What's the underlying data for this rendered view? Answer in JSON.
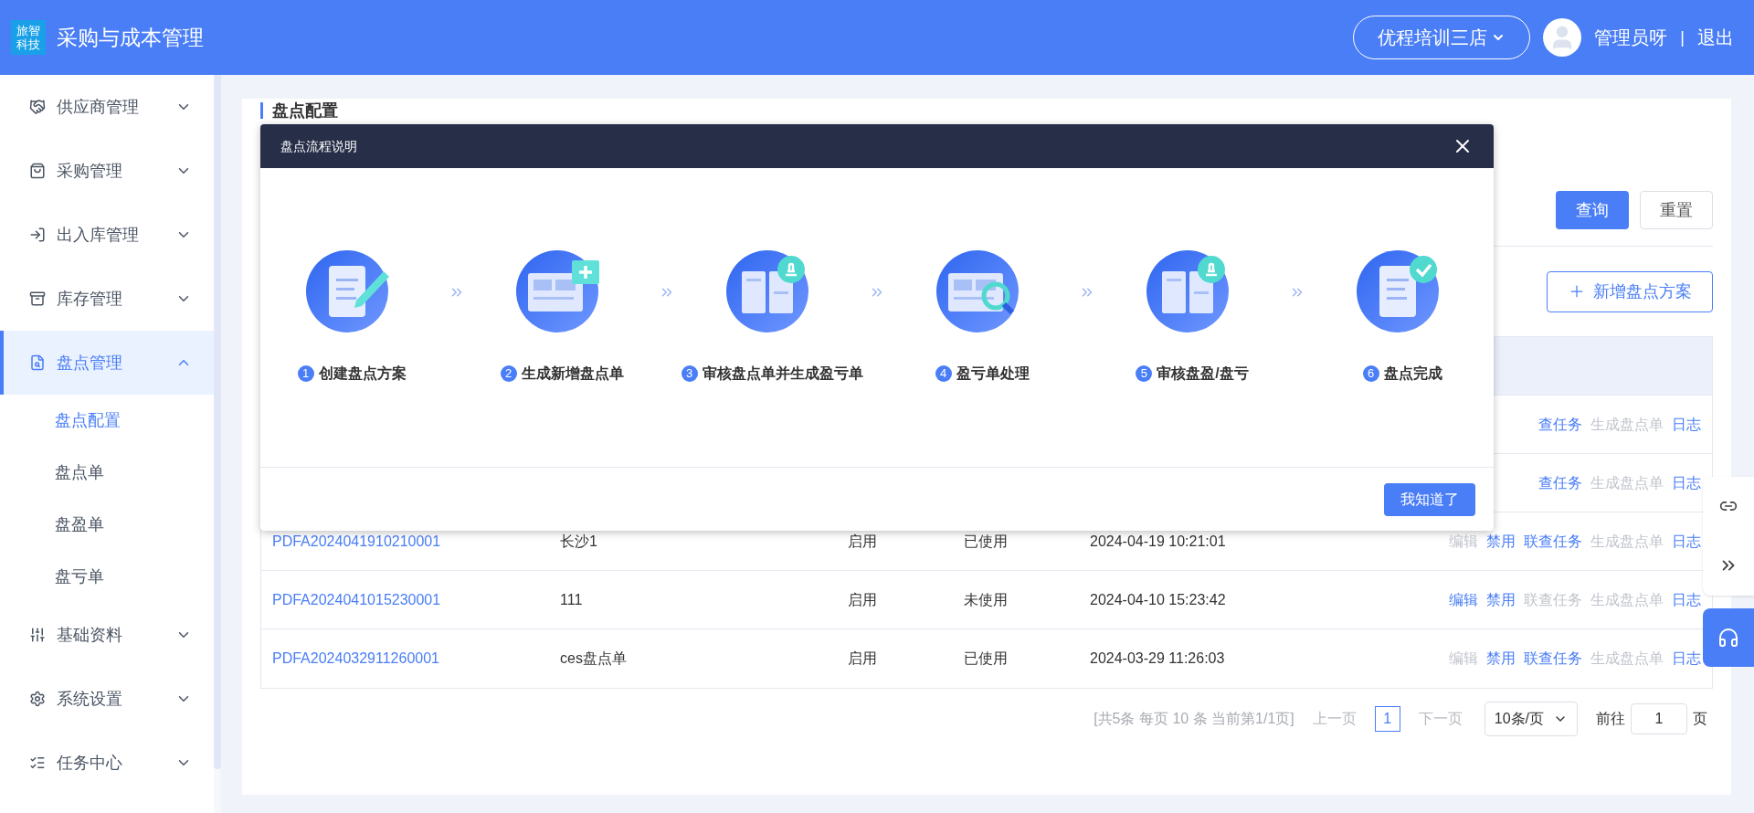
{
  "header": {
    "logo_lines": [
      "旅智",
      "科技"
    ],
    "title": "采购与成本管理",
    "store": "优程培训三店",
    "user": "管理员呀",
    "separator": "|",
    "logout": "退出"
  },
  "sidebar": {
    "items": [
      {
        "label": "供应商管理",
        "expanded": false,
        "selected": false
      },
      {
        "label": "采购管理",
        "expanded": false,
        "selected": false
      },
      {
        "label": "出入库管理",
        "expanded": false,
        "selected": false
      },
      {
        "label": "库存管理",
        "expanded": false,
        "selected": false
      },
      {
        "label": "盘点管理",
        "expanded": true,
        "selected": true,
        "children": [
          {
            "label": "盘点配置",
            "selected": true
          },
          {
            "label": "盘点单",
            "selected": false
          },
          {
            "label": "盘盈单",
            "selected": false
          },
          {
            "label": "盘亏单",
            "selected": false
          }
        ]
      },
      {
        "label": "基础资料",
        "expanded": false,
        "selected": false
      },
      {
        "label": "系统设置",
        "expanded": false,
        "selected": false
      },
      {
        "label": "任务中心",
        "expanded": false,
        "selected": false
      }
    ]
  },
  "page_title": "盘点配置",
  "filter_buttons": [
    {
      "label": "查询",
      "kind": "primary"
    },
    {
      "label": "重置",
      "kind": "plain"
    }
  ],
  "add_button": "新增盘点方案",
  "table": {
    "rows": [
      {
        "actions": [
          {
            "label": "查任务",
            "disabled": false
          },
          {
            "label": "生成盘点单",
            "disabled": true
          },
          {
            "label": "日志",
            "disabled": false
          }
        ]
      },
      {
        "actions": [
          {
            "label": "查任务",
            "disabled": false
          },
          {
            "label": "生成盘点单",
            "disabled": true
          },
          {
            "label": "日志",
            "disabled": false
          }
        ]
      },
      {
        "code": "PDFA2024041910210001",
        "name": "长沙1",
        "status": "启用",
        "usage": "已使用",
        "time": "2024-04-19 10:21:01",
        "actions": [
          {
            "label": "编辑",
            "disabled": true
          },
          {
            "label": "禁用",
            "disabled": false
          },
          {
            "label": "联查任务",
            "disabled": false
          },
          {
            "label": "生成盘点单",
            "disabled": true
          },
          {
            "label": "日志",
            "disabled": false
          }
        ]
      },
      {
        "code": "PDFA2024041015230001",
        "name": "111",
        "status": "启用",
        "usage": "未使用",
        "time": "2024-04-10 15:23:42",
        "actions": [
          {
            "label": "编辑",
            "disabled": false
          },
          {
            "label": "禁用",
            "disabled": false
          },
          {
            "label": "联查任务",
            "disabled": true
          },
          {
            "label": "生成盘点单",
            "disabled": true
          },
          {
            "label": "日志",
            "disabled": false
          }
        ]
      },
      {
        "code": "PDFA2024032911260001",
        "name": "ces盘点单",
        "status": "启用",
        "usage": "已使用",
        "time": "2024-03-29 11:26:03",
        "actions": [
          {
            "label": "编辑",
            "disabled": true
          },
          {
            "label": "禁用",
            "disabled": false
          },
          {
            "label": "联查任务",
            "disabled": false
          },
          {
            "label": "生成盘点单",
            "disabled": true
          },
          {
            "label": "日志",
            "disabled": false
          }
        ]
      }
    ]
  },
  "pagination": {
    "summary": "[共5条 每页 10 条 当前第1/1页]",
    "prev": {
      "label": "上一页",
      "disabled": true
    },
    "pages": [
      {
        "label": "1",
        "selected": true
      }
    ],
    "next": {
      "label": "下一页",
      "disabled": true
    },
    "page_size": "10条/页",
    "goto_label": "前往",
    "goto_value": "1",
    "goto_suffix": "页"
  },
  "dialog": {
    "title": "盘点流程说明",
    "steps": [
      {
        "num": "1",
        "label": "创建盘点方案"
      },
      {
        "num": "2",
        "label": "生成新增盘点单"
      },
      {
        "num": "3",
        "label": "审核盘点单并生成盈亏单"
      },
      {
        "num": "4",
        "label": "盈亏单处理"
      },
      {
        "num": "5",
        "label": "审核盘盈/盘亏"
      },
      {
        "num": "6",
        "label": "盘点完成"
      }
    ],
    "confirm": "我知道了"
  }
}
